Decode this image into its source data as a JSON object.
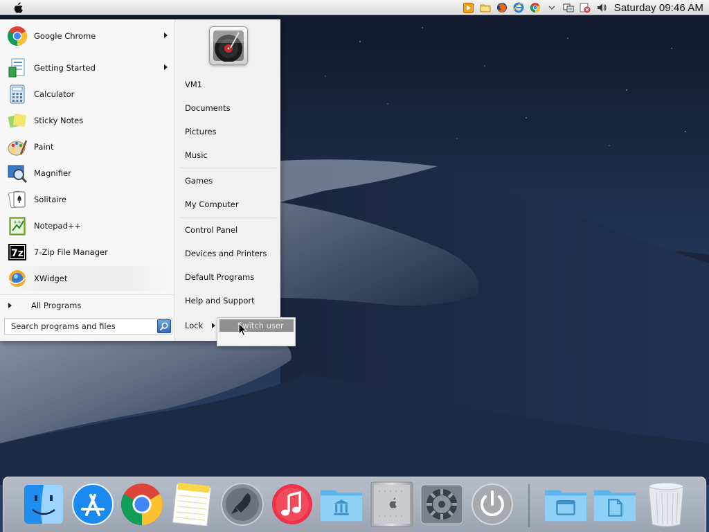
{
  "menubar": {
    "clock": "Saturday 09:46 AM",
    "tray_icons": [
      "media-player-icon",
      "folder-icon",
      "firefox-icon",
      "ie-icon",
      "chrome-icon",
      "chevron-down-icon",
      "network-icon",
      "security-icon",
      "volume-icon"
    ]
  },
  "start_menu": {
    "programs": [
      {
        "label": "Google Chrome",
        "icon": "chrome-icon",
        "submenu": true
      },
      {
        "label": "Getting Started",
        "icon": "getting-started-icon",
        "submenu": true
      },
      {
        "label": "Calculator",
        "icon": "calculator-icon",
        "submenu": false
      },
      {
        "label": "Sticky Notes",
        "icon": "sticky-notes-icon",
        "submenu": false
      },
      {
        "label": "Paint",
        "icon": "paint-icon",
        "submenu": false
      },
      {
        "label": "Magnifier",
        "icon": "magnifier-icon",
        "submenu": false
      },
      {
        "label": "Solitaire",
        "icon": "solitaire-icon",
        "submenu": false
      },
      {
        "label": "Notepad++",
        "icon": "notepad-plus-icon",
        "submenu": false
      },
      {
        "label": "7-Zip File Manager",
        "icon": "7zip-icon",
        "submenu": false
      },
      {
        "label": "XWidget",
        "icon": "xwidget-icon",
        "submenu": false
      }
    ],
    "all_programs": "All Programs",
    "search_placeholder": "Search programs and files",
    "places": [
      {
        "label": "VM1"
      },
      {
        "label": "Documents"
      },
      {
        "label": "Pictures"
      },
      {
        "label": "Music"
      },
      {
        "label": "Games"
      },
      {
        "label": "My Computer"
      },
      {
        "label": "Control Panel"
      },
      {
        "label": "Devices and Printers"
      },
      {
        "label": "Default Programs"
      },
      {
        "label": "Help and Support"
      }
    ],
    "lock_label": "Lock",
    "lock_submenu": {
      "switch_user": "Switch user"
    }
  },
  "dock": {
    "items": [
      "finder-icon",
      "app-store-icon",
      "chrome-icon",
      "notes-icon",
      "launchpad-icon",
      "itunes-icon",
      "applications-folder-icon",
      "mac-pro-icon",
      "system-preferences-icon",
      "power-icon",
      "documents-folder-icon",
      "files-folder-icon",
      "trash-icon"
    ]
  },
  "colors": {
    "accent_blue": "#2e69b8",
    "submenu_highlight": "#8f8f8f",
    "wallpaper_sky": "#1d2b47"
  }
}
